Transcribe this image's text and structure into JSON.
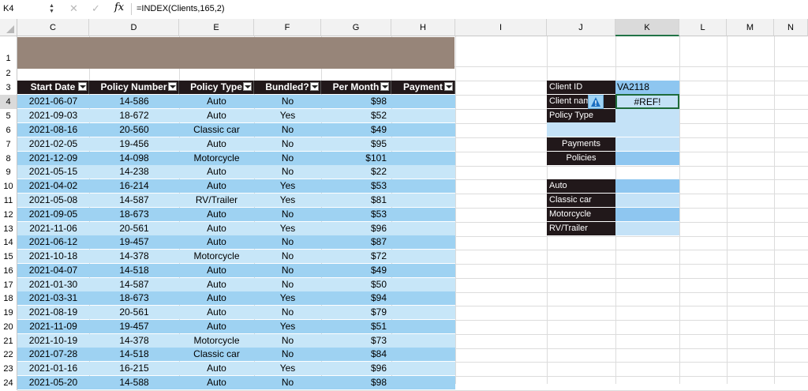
{
  "formula_bar": {
    "name_box": "K4",
    "formula": "=INDEX(Clients,165,2)",
    "fx_label": "fx"
  },
  "columns": [
    "C",
    "D",
    "E",
    "F",
    "G",
    "H",
    "I",
    "J",
    "K",
    "L",
    "M",
    "N"
  ],
  "selected_column": "K",
  "rows": [
    "1",
    "2",
    "3",
    "4",
    "5",
    "6",
    "7",
    "8",
    "9",
    "10",
    "11",
    "12",
    "13",
    "14",
    "15",
    "16",
    "17",
    "18",
    "19",
    "20",
    "21",
    "22",
    "23",
    "24"
  ],
  "selected_row": "4",
  "table": {
    "headers": [
      "Start Date",
      "Policy Number",
      "Policy Type",
      "Bundled?",
      "Per Month",
      "Payment"
    ],
    "rows": [
      [
        "2021-06-07",
        "14-586",
        "Auto",
        "No",
        "$98",
        ""
      ],
      [
        "2021-09-03",
        "18-672",
        "Auto",
        "Yes",
        "$52",
        ""
      ],
      [
        "2021-08-16",
        "20-560",
        "Classic car",
        "No",
        "$49",
        ""
      ],
      [
        "2021-02-05",
        "19-456",
        "Auto",
        "No",
        "$95",
        ""
      ],
      [
        "2021-12-09",
        "14-098",
        "Motorcycle",
        "No",
        "$101",
        ""
      ],
      [
        "2021-05-15",
        "14-238",
        "Auto",
        "No",
        "$22",
        ""
      ],
      [
        "2021-04-02",
        "16-214",
        "Auto",
        "Yes",
        "$53",
        ""
      ],
      [
        "2021-05-08",
        "14-587",
        "RV/Trailer",
        "Yes",
        "$81",
        ""
      ],
      [
        "2021-09-05",
        "18-673",
        "Auto",
        "No",
        "$53",
        ""
      ],
      [
        "2021-11-06",
        "20-561",
        "Auto",
        "Yes",
        "$96",
        ""
      ],
      [
        "2021-06-12",
        "19-457",
        "Auto",
        "No",
        "$87",
        ""
      ],
      [
        "2021-10-18",
        "14-378",
        "Motorcycle",
        "No",
        "$72",
        ""
      ],
      [
        "2021-04-07",
        "14-518",
        "Auto",
        "No",
        "$49",
        ""
      ],
      [
        "2021-01-30",
        "14-587",
        "Auto",
        "No",
        "$50",
        ""
      ],
      [
        "2021-03-31",
        "18-673",
        "Auto",
        "Yes",
        "$94",
        ""
      ],
      [
        "2021-08-19",
        "20-561",
        "Auto",
        "No",
        "$79",
        ""
      ],
      [
        "2021-11-09",
        "19-457",
        "Auto",
        "Yes",
        "$51",
        ""
      ],
      [
        "2021-10-19",
        "14-378",
        "Motorcycle",
        "No",
        "$73",
        ""
      ],
      [
        "2021-07-28",
        "14-518",
        "Classic car",
        "No",
        "$84",
        ""
      ],
      [
        "2021-01-16",
        "16-215",
        "Auto",
        "Yes",
        "$96",
        ""
      ],
      [
        "2021-05-20",
        "14-588",
        "Auto",
        "No",
        "$98",
        ""
      ]
    ]
  },
  "panel": {
    "client_id_label": "Client ID",
    "client_id_value": "VA2118",
    "client_name_label": "Client name",
    "client_name_value": "#REF!",
    "policy_type_label": "Policy Type",
    "payments_label": "Payments",
    "policies_label": "Policies",
    "types": [
      "Auto",
      "Classic car",
      "Motorcycle",
      "RV/Trailer"
    ]
  },
  "colors": {
    "header_dark": "#21181a",
    "banner": "#978579",
    "row_blue_dark": "#9ed2f2",
    "row_blue_light": "#c7e6f8",
    "panel_blue_dark": "#8ec6f0",
    "panel_blue_light": "#c4e2f7"
  }
}
